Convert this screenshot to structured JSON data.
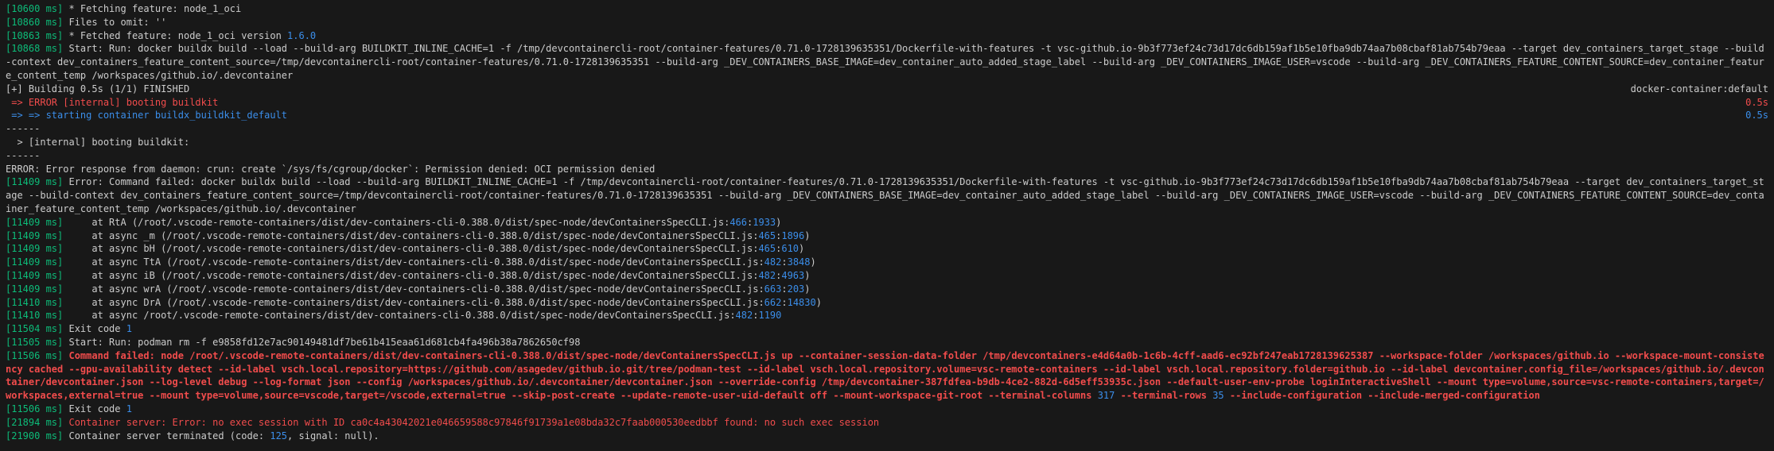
{
  "lines": [
    [
      [
        "g",
        "[10600 ms]"
      ],
      [
        "",
        "* Fetching feature: node_1_oci"
      ]
    ],
    [
      [
        "g",
        "[10860 ms]"
      ],
      [
        "",
        "Files to omit: ''"
      ]
    ],
    [
      [
        "g",
        "[10863 ms]"
      ],
      [
        "",
        "* Fetched feature: node_1_oci version "
      ],
      [
        "n",
        "1.6.0"
      ]
    ],
    [
      [
        "g",
        "[10868 ms]"
      ],
      [
        "",
        "Start: Run: docker buildx build --load --build-arg BUILDKIT_INLINE_CACHE=1 -f /tmp/devcontainercli-root/container-features/0.71.0-1728139635351/Dockerfile-with-features -t vsc-github.io-9b3f773ef24c73d17dc6db159af1b5e10fba9db74aa7b08cbaf81ab754b79eaa --target dev_containers_target_stage --build-context dev_containers_feature_content_source=/tmp/devcontainercli-root/container-features/0.71.0-1728139635351 --build-arg _DEV_CONTAINERS_BASE_IMAGE=dev_container_auto_added_stage_label --build-arg _DEV_CONTAINERS_IMAGE_USER=vscode --build-arg _DEV_CONTAINERS_FEATURE_CONTENT_SOURCE=dev_container_feature_content_temp /workspaces/github.io/.devcontainer"
      ]
    ],
    {
      "left": [
        [
          "",
          "[+] Building 0.5s (1/1) FINISHED"
        ]
      ],
      "right": [
        [
          "",
          "docker-container:default"
        ]
      ]
    },
    {
      "left": [
        [
          "r",
          " => ERROR [internal] booting buildkit"
        ]
      ],
      "right": [
        [
          "r",
          "0.5s"
        ]
      ]
    },
    {
      "left": [
        [
          "b",
          " => => starting container buildx_buildkit_default"
        ]
      ],
      "right": [
        [
          "b",
          "0.5s"
        ]
      ]
    },
    [
      [
        "",
        "------"
      ]
    ],
    [
      [
        "",
        "  > [internal] booting buildkit:"
      ]
    ],
    [
      [
        "",
        "------"
      ]
    ],
    [
      [
        "",
        "ERROR: Error response from daemon: crun: create `/sys/fs/cgroup/docker`: Permission denied: OCI permission denied"
      ]
    ],
    [
      [
        "g",
        "[11409 ms]"
      ],
      [
        "",
        "Error: Command failed: docker buildx build --load --build-arg BUILDKIT_INLINE_CACHE=1 -f /tmp/devcontainercli-root/container-features/0.71.0-1728139635351/Dockerfile-with-features -t vsc-github.io-9b3f773ef24c73d17dc6db159af1b5e10fba9db74aa7b08cbaf81ab754b79eaa --target dev_containers_target_stage --build-context dev_containers_feature_content_source=/tmp/devcontainercli-root/container-features/0.71.0-1728139635351 --build-arg _DEV_CONTAINERS_BASE_IMAGE=dev_container_auto_added_stage_label --build-arg _DEV_CONTAINERS_IMAGE_USER=vscode --build-arg _DEV_CONTAINERS_FEATURE_CONTENT_SOURCE=dev_container_feature_content_temp /workspaces/github.io/.devcontainer"
      ]
    ],
    [
      [
        "g",
        "[11409 ms]"
      ],
      [
        "",
        "    at RtA (/root/.vscode-remote-containers/dist/dev-containers-cli-0.388.0/dist/spec-node/devContainersSpecCLI.js:"
      ],
      [
        "n",
        "466"
      ],
      [
        "",
        ":"
      ],
      [
        "n",
        "1933"
      ],
      [
        "",
        ")"
      ]
    ],
    [
      [
        "g",
        "[11409 ms]"
      ],
      [
        "",
        "    at async _m (/root/.vscode-remote-containers/dist/dev-containers-cli-0.388.0/dist/spec-node/devContainersSpecCLI.js:"
      ],
      [
        "n",
        "465"
      ],
      [
        "",
        ":"
      ],
      [
        "n",
        "1896"
      ],
      [
        "",
        ")"
      ]
    ],
    [
      [
        "g",
        "[11409 ms]"
      ],
      [
        "",
        "    at async bH (/root/.vscode-remote-containers/dist/dev-containers-cli-0.388.0/dist/spec-node/devContainersSpecCLI.js:"
      ],
      [
        "n",
        "465"
      ],
      [
        "",
        ":"
      ],
      [
        "n",
        "610"
      ],
      [
        "",
        ")"
      ]
    ],
    [
      [
        "g",
        "[11409 ms]"
      ],
      [
        "",
        "    at async TtA (/root/.vscode-remote-containers/dist/dev-containers-cli-0.388.0/dist/spec-node/devContainersSpecCLI.js:"
      ],
      [
        "n",
        "482"
      ],
      [
        "",
        ":"
      ],
      [
        "n",
        "3848"
      ],
      [
        "",
        ")"
      ]
    ],
    [
      [
        "g",
        "[11409 ms]"
      ],
      [
        "",
        "    at async iB (/root/.vscode-remote-containers/dist/dev-containers-cli-0.388.0/dist/spec-node/devContainersSpecCLI.js:"
      ],
      [
        "n",
        "482"
      ],
      [
        "",
        ":"
      ],
      [
        "n",
        "4963"
      ],
      [
        "",
        ")"
      ]
    ],
    [
      [
        "g",
        "[11409 ms]"
      ],
      [
        "",
        "    at async wrA (/root/.vscode-remote-containers/dist/dev-containers-cli-0.388.0/dist/spec-node/devContainersSpecCLI.js:"
      ],
      [
        "n",
        "663"
      ],
      [
        "",
        ":"
      ],
      [
        "n",
        "203"
      ],
      [
        "",
        ")"
      ]
    ],
    [
      [
        "g",
        "[11410 ms]"
      ],
      [
        "",
        "    at async DrA (/root/.vscode-remote-containers/dist/dev-containers-cli-0.388.0/dist/spec-node/devContainersSpecCLI.js:"
      ],
      [
        "n",
        "662"
      ],
      [
        "",
        ":"
      ],
      [
        "n",
        "14830"
      ],
      [
        "",
        ")"
      ]
    ],
    [
      [
        "g",
        "[11410 ms]"
      ],
      [
        "",
        "    at async /root/.vscode-remote-containers/dist/dev-containers-cli-0.388.0/dist/spec-node/devContainersSpecCLI.js:"
      ],
      [
        "n",
        "482"
      ],
      [
        "",
        ":"
      ],
      [
        "n",
        "1190"
      ]
    ],
    [
      [
        "g",
        "[11504 ms]"
      ],
      [
        "",
        "Exit code "
      ],
      [
        "n",
        "1"
      ]
    ],
    [
      [
        "g",
        "[11505 ms]"
      ],
      [
        "",
        "Start: Run: podman rm -f e9858fd12e7ac90149481df7be61b415eaa61d681cb4fa496b38a7862650cf98"
      ]
    ],
    [
      [
        "g",
        "[11506 ms]"
      ],
      [
        "rb",
        "Command failed: node /root/.vscode-remote-containers/dist/dev-containers-cli-0.388.0/dist/spec-node/devContainersSpecCLI.js up --container-session-data-folder /tmp/devcontainers-e4d64a0b-1c6b-4cff-aad6-ec92bf247eab1728139625387 --workspace-folder /workspaces/github.io --workspace-mount-consistency cached --gpu-availability detect --id-label vsch.local.repository=https://github.com/asagedev/github.io.git/tree/podman-test --id-label vsch.local.repository.volume=vsc-remote-containers --id-label vsch.local.repository.folder=github.io --id-label devcontainer.config_file=/workspaces/github.io/.devcontainer/devcontainer.json --log-level debug --log-format json --config /workspaces/github.io/.devcontainer/devcontainer.json --override-config /tmp/devcontainer-387fdfea-b9db-4ce2-882d-6d5eff53935c.json --default-user-env-probe loginInteractiveShell --mount type=volume,source=vsc-remote-containers,target=/workspaces,external=true --mount type=volume,source=vscode,target=/vscode,external=true --skip-post-create --update-remote-user-uid-default off --mount-workspace-git-root --terminal-columns "
      ],
      [
        "n",
        "317"
      ],
      [
        "rb",
        " --terminal-rows "
      ],
      [
        "n",
        "35"
      ],
      [
        "rb",
        " --include-configuration --include-merged-configuration"
      ]
    ],
    [
      [
        "g",
        "[11506 ms]"
      ],
      [
        "",
        "Exit code "
      ],
      [
        "n",
        "1"
      ]
    ],
    [
      [
        "g",
        "[21894 ms]"
      ],
      [
        "r",
        "Container server: Error: no exec session with ID ca0c4a43042021e046659588c97846f91739a1e08bda32c7faab000530eedbbf found: no such exec session"
      ]
    ],
    [
      [
        "g",
        "[21900 ms]"
      ],
      [
        "",
        "Container server terminated (code: "
      ],
      [
        "n",
        "125"
      ],
      [
        "",
        ", signal: null)."
      ]
    ]
  ]
}
